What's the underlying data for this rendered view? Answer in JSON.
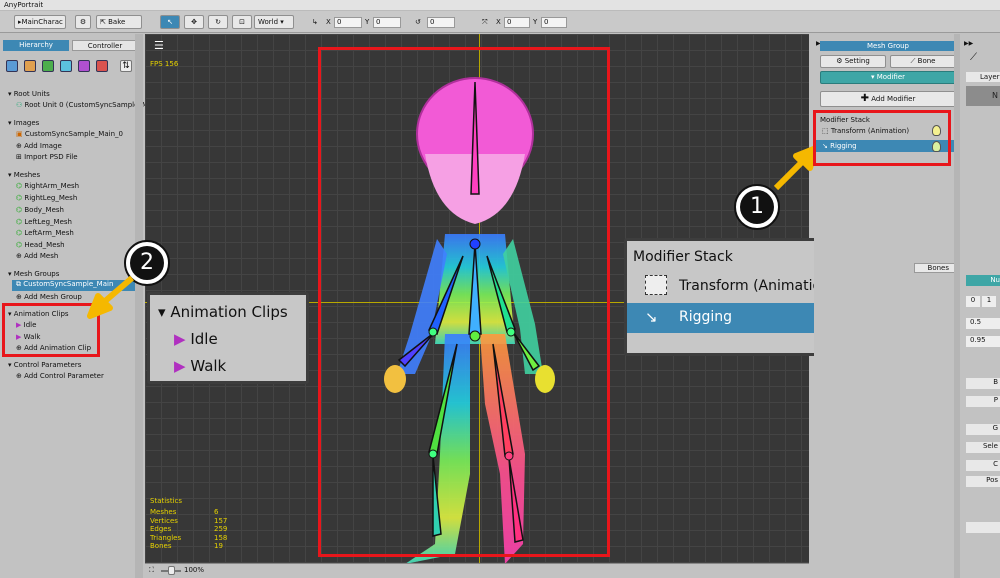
{
  "app": {
    "title": "AnyPortrait"
  },
  "toolbar": {
    "dropdown_value": "MainCharac",
    "bake_label": "Bake",
    "space_value": "World",
    "x_label": "X",
    "x_value": "0",
    "y_label": "Y",
    "y_value": "0",
    "rot_value": "0",
    "sx_label": "X",
    "sx_value": "0",
    "sy_label": "Y",
    "sy_value": "0"
  },
  "left": {
    "tab_hierarchy": "Hierarchy",
    "tab_controller": "Controller",
    "sections": {
      "root_units": "Root Units",
      "root_unit_0": "Root Unit 0 (CustomSyncSample_M",
      "images": "Images",
      "image_0": "CustomSyncSample_Main_0",
      "add_image": "Add Image",
      "import_psd": "Import PSD File",
      "meshes": "Meshes",
      "mesh_items": [
        "RightArm_Mesh",
        "RightLeg_Mesh",
        "Body_Mesh",
        "LeftLeg_Mesh",
        "LeftArm_Mesh",
        "Head_Mesh"
      ],
      "add_mesh": "Add Mesh",
      "mesh_groups": "Mesh Groups",
      "mesh_group_0": "CustomSyncSample_Main",
      "add_mesh_group": "Add Mesh Group",
      "animation_clips": "Animation Clips",
      "clip_idle": "Idle",
      "clip_walk": "Walk",
      "add_animation_clip": "Add Animation Clip",
      "control_parameters": "Control Parameters",
      "add_control_parameter": "Add Control Parameter"
    }
  },
  "viewport": {
    "fps": "FPS 156",
    "statistics_title": "Statistics",
    "stats": [
      {
        "label": "Meshes",
        "value": "6"
      },
      {
        "label": "Vertices",
        "value": "157"
      },
      {
        "label": "Edges",
        "value": "259"
      },
      {
        "label": "Triangles",
        "value": "158"
      },
      {
        "label": "Bones",
        "value": "19"
      }
    ],
    "zoom": "100%"
  },
  "callout_clips": {
    "title": "Animation Clips",
    "idle": "Idle",
    "walk": "Walk"
  },
  "callout_stack": {
    "title": "Modifier Stack",
    "item1": "Transform (Animation)",
    "item2": "Rigging"
  },
  "badges": {
    "one": "1",
    "two": "2"
  },
  "right": {
    "header": "Mesh Group",
    "setting": "Setting",
    "bone": "Bone",
    "modifier": "Modifier",
    "add_modifier": "Add Modifier",
    "modifier_stack": "Modifier Stack",
    "stack_item1": "Transform (Animation)",
    "stack_item2": "Rigging",
    "bones_label": "Bones"
  },
  "right2": {
    "layer": "Layer",
    "n": "N",
    "nu": "Nu",
    "v0": "0",
    "v1": "1",
    "v05": "0.5",
    "v095": "0.95",
    "b": "B",
    "p": "P",
    "g": "G",
    "sele": "Sele",
    "c": "C",
    "pos": "Pos"
  },
  "colors": {
    "accent": "#3d88b4",
    "red": "#e8161b",
    "callout_bg": "#3d3d3d",
    "arrow": "#f5b800"
  }
}
